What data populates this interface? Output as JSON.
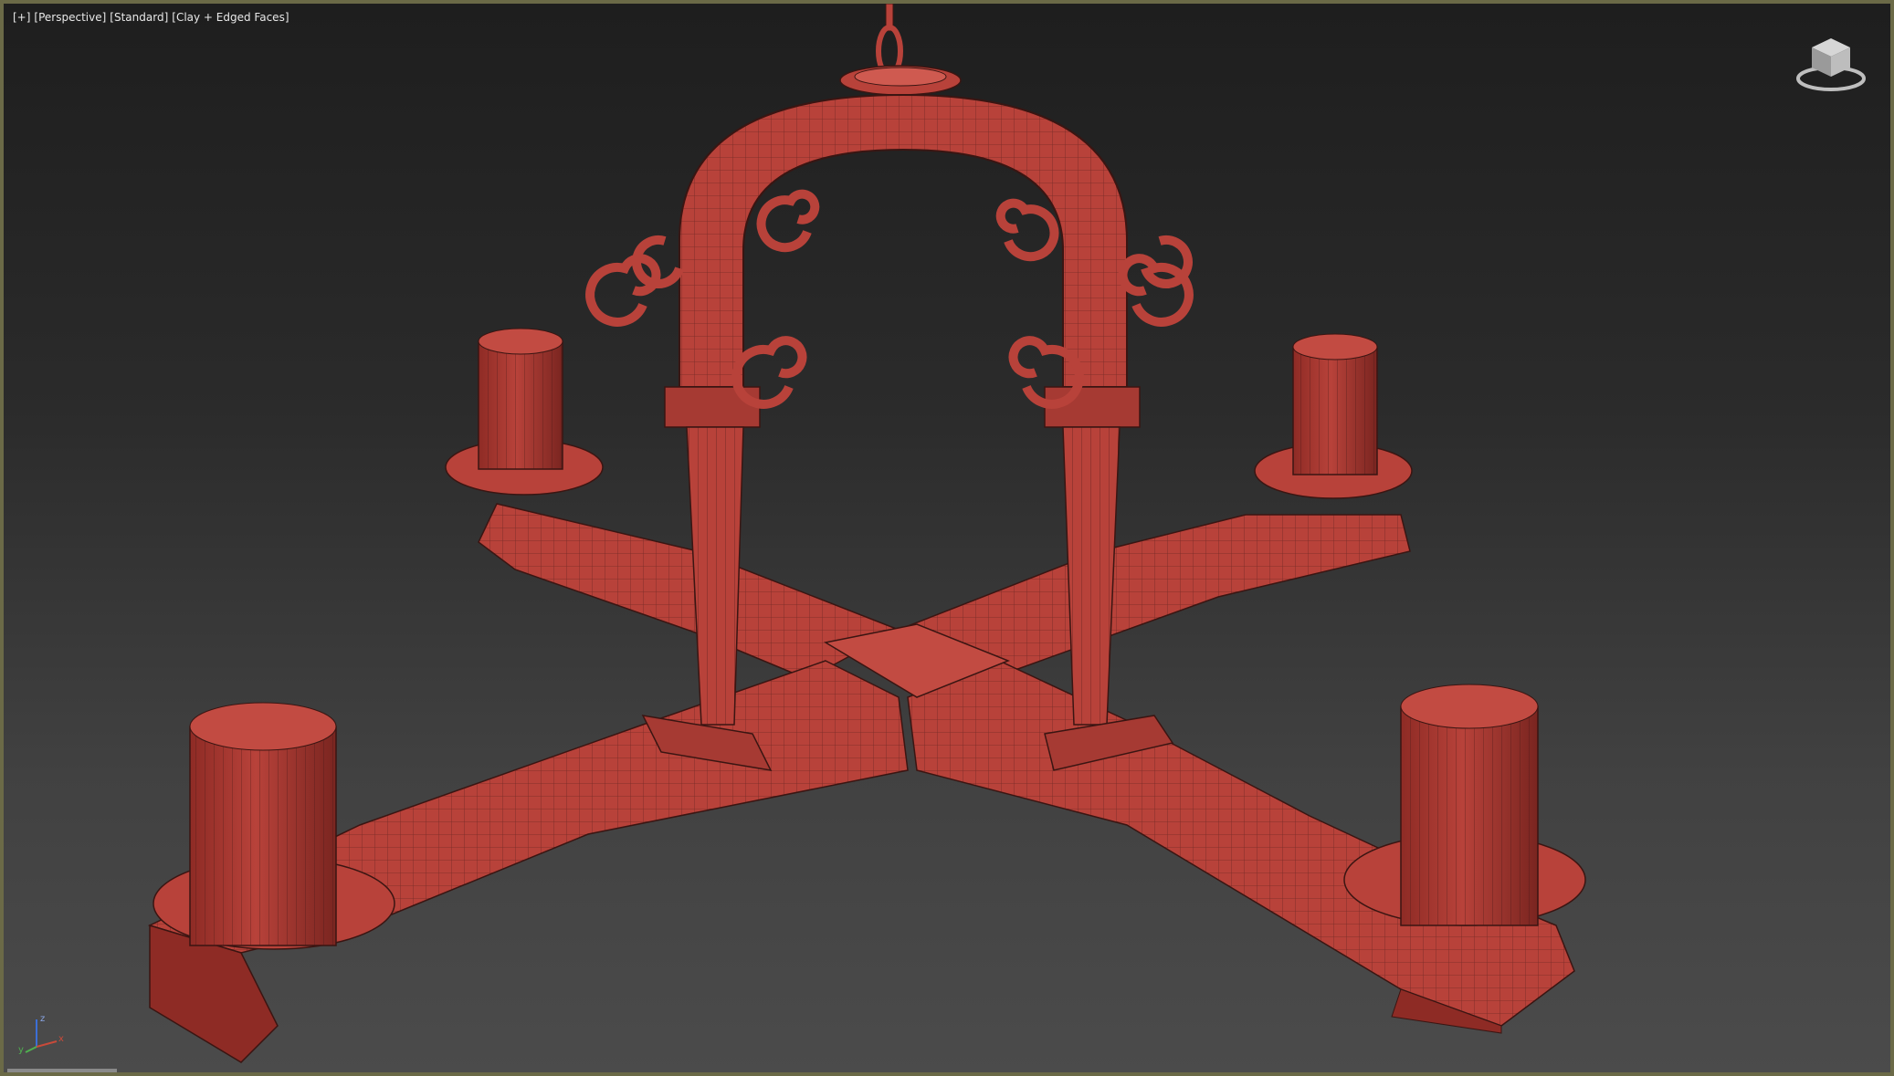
{
  "viewport": {
    "labels": [
      "[+]",
      "[Perspective]",
      "[Standard]",
      "[Clay + Edged Faces]"
    ],
    "border_color": "#6b6a47"
  },
  "scene": {
    "object": "chandelier",
    "material_color": "#b8423a",
    "shadow_color": "#8e2b25",
    "highlight_color": "#cf5a50",
    "wire_color": "#3a1512"
  },
  "icons": {
    "viewcube": "viewcube-icon",
    "axis": "axis-tripod-icon"
  },
  "axis": {
    "z_label": "z",
    "x_label": "x",
    "y_label": "y"
  }
}
